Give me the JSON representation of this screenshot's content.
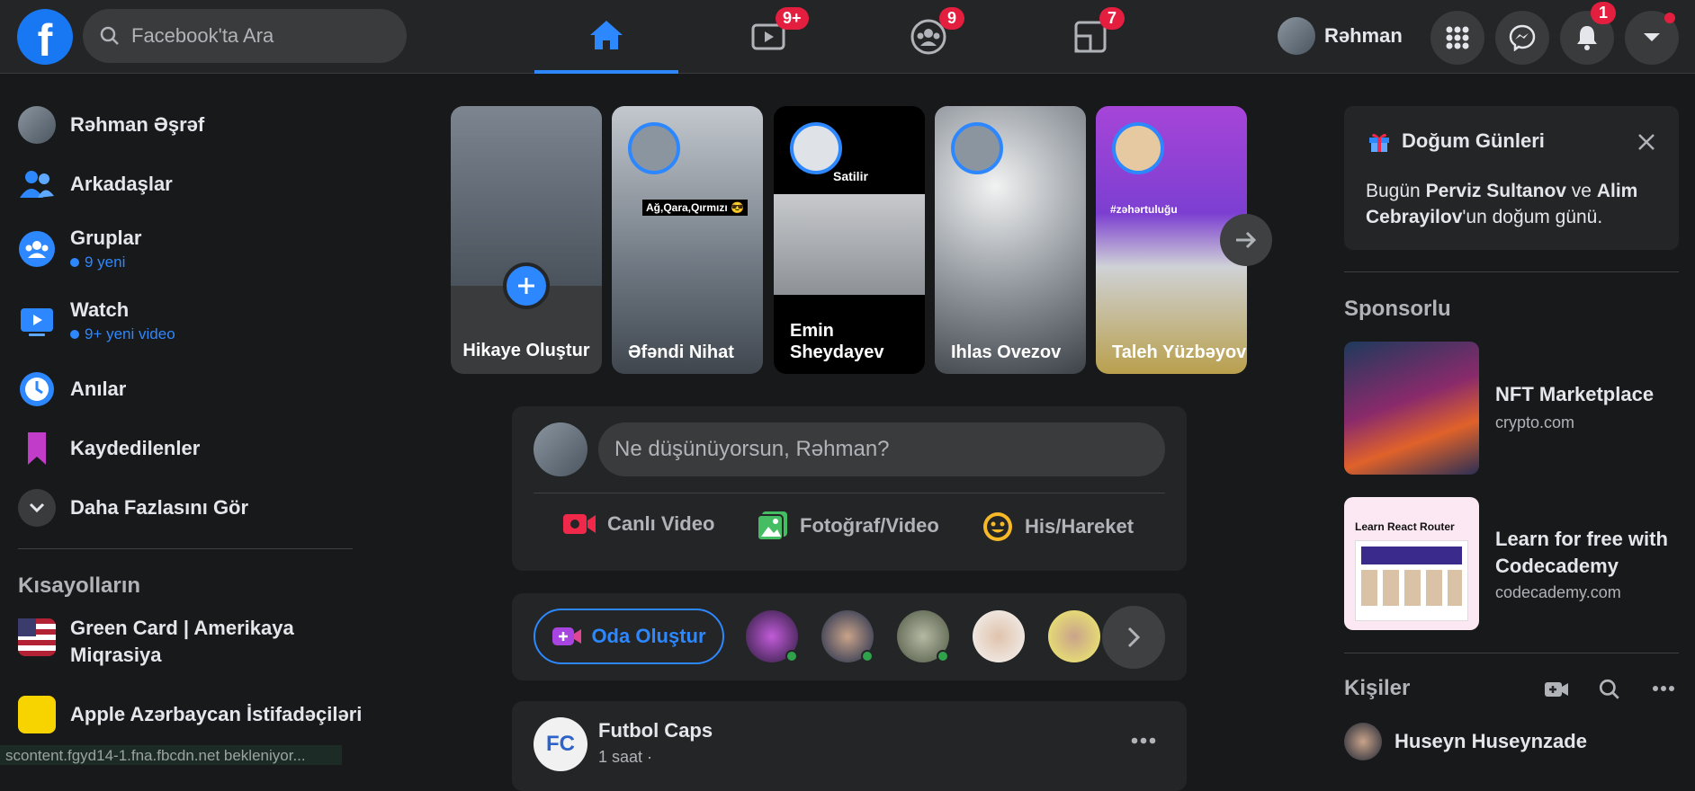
{
  "topbar": {
    "logo": "f",
    "search_placeholder": "Facebook'ta Ara",
    "tabs": [
      {
        "name": "home-icon",
        "badge": ""
      },
      {
        "name": "watch-icon",
        "badge": "9+"
      },
      {
        "name": "groups-icon",
        "badge": "9"
      },
      {
        "name": "gaming-icon",
        "badge": "7"
      }
    ],
    "profile_name": "Rəhman",
    "notifications_badge": "1"
  },
  "leftnav": {
    "profile": "Rəhman Əşrəf",
    "items": [
      {
        "label": "Arkadaşlar",
        "sub": ""
      },
      {
        "label": "Gruplar",
        "sub": "9 yeni"
      },
      {
        "label": "Watch",
        "sub": "9+ yeni video"
      },
      {
        "label": "Anılar",
        "sub": ""
      },
      {
        "label": "Kaydedilenler",
        "sub": ""
      },
      {
        "label": "Daha Fazlasını Gör",
        "sub": ""
      }
    ],
    "shortcuts_title": "Kısayolların",
    "shortcuts": [
      {
        "label": "Green Card | Amerikaya Miqrasiya"
      },
      {
        "label": "Apple Azərbaycan İstifadəçiləri"
      }
    ]
  },
  "stories": [
    {
      "name": "Hikaye Oluştur",
      "overlay": ""
    },
    {
      "name": "Əfəndi Nihat",
      "overlay": "Ağ,Qara,Qırmızı 😎"
    },
    {
      "name": "Emin Sheydayev",
      "overlay": "Satilir"
    },
    {
      "name": "Ihlas Ovezov",
      "overlay": ""
    },
    {
      "name": "Taleh Yüzbəyov",
      "overlay": "#zəhərtuluğu"
    }
  ],
  "composer": {
    "placeholder": "Ne düşünüyorsun, Rəhman?",
    "actions": [
      "Canlı Video",
      "Fotoğraf/Video",
      "His/Hareket"
    ]
  },
  "rooms": {
    "button": "Oda Oluştur"
  },
  "post": {
    "author": "Futbol Caps",
    "time": "1 saat ·",
    "avatar_text": "FC"
  },
  "right": {
    "birthdays_title": "Doğum Günleri",
    "birthday_text_1": "Bugün ",
    "birthday_name_1": "Perviz Sultanov",
    "birthday_text_2": " ve ",
    "birthday_name_2": "Alim Cebrayilov",
    "birthday_text_3": "'un doğum günü.",
    "sponsored_title": "Sponsorlu",
    "ads": [
      {
        "title": "NFT Marketplace",
        "domain": "crypto.com"
      },
      {
        "title": "Learn for free with Codecademy",
        "domain": "codecademy.com",
        "thumb_title": "Learn React Router"
      }
    ],
    "contacts_title": "Kişiler",
    "contacts": [
      {
        "name": "Huseyn Huseynzade"
      }
    ]
  },
  "statusbar": "scontent.fgyd14-1.fna.fbcdn.net bekleniyor...",
  "colors": {
    "accent": "#2d88ff",
    "badge": "#e41e3f",
    "bg": "#18191a",
    "surface": "#242526"
  }
}
